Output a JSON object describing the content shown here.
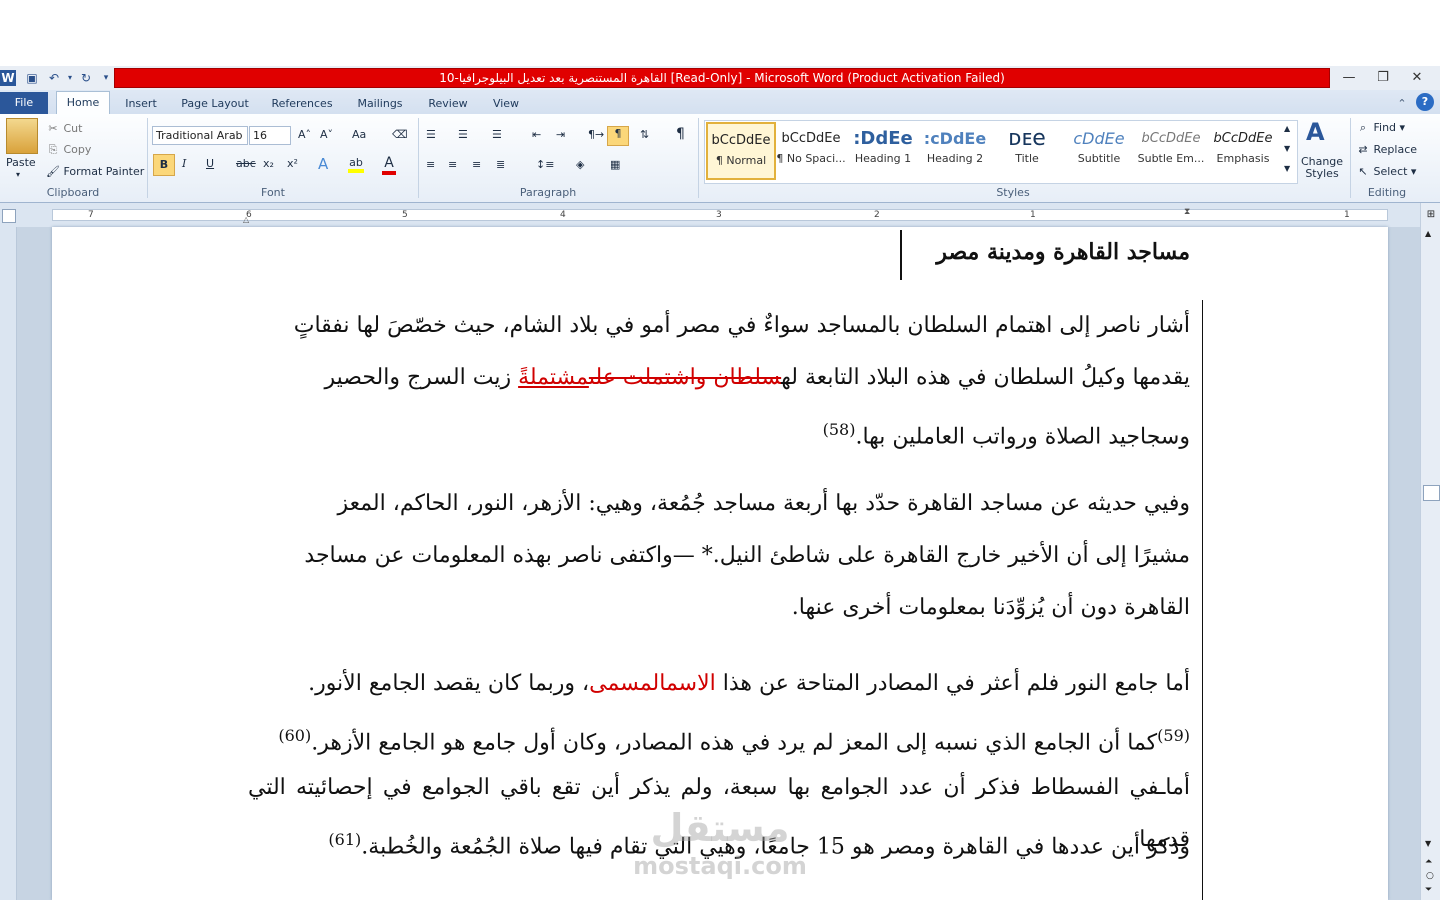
{
  "window": {
    "title": "القاهرة المستنصرية بعد تعديل البيلوجرافيا-10 [Read-Only] - Microsoft Word (Product Activation Failed)",
    "qat": [
      "word-app-icon",
      "save-icon",
      "undo-icon",
      "redo-icon",
      "customize-qat-icon"
    ],
    "controls": [
      "minimize-icon",
      "restore-icon",
      "close-icon"
    ]
  },
  "tabs": [
    "File",
    "Home",
    "Insert",
    "Page Layout",
    "References",
    "Mailings",
    "Review",
    "View"
  ],
  "clipboard": {
    "paste": "Paste",
    "cut": "Cut",
    "copy": "Copy",
    "format_painter": "Format Painter",
    "label": "Clipboard"
  },
  "font": {
    "name": "Traditional Arab",
    "size": "16",
    "label": "Font",
    "bold": "B",
    "italic": "I",
    "underline": "U",
    "strike": "abc",
    "sub": "x₂",
    "sup": "x²",
    "grow": "A˄",
    "shrink": "A˅",
    "case": "Aa",
    "effects": "A",
    "color": "A"
  },
  "paragraph": {
    "label": "Paragraph"
  },
  "styles": {
    "label": "Styles",
    "items": [
      {
        "preview": "bCcDdEe",
        "name": "¶ Normal",
        "color": "#000000"
      },
      {
        "preview": "bCcDdEe",
        "name": "¶ No Spaci...",
        "color": "#000000"
      },
      {
        "preview": ":DdEe",
        "name": "Heading 1",
        "color": "#2e5f9e"
      },
      {
        "preview": ":cDdEe",
        "name": "Heading 2",
        "color": "#4f81bd"
      },
      {
        "preview": "ᴅᴇe",
        "name": "Title",
        "color": "#17365d"
      },
      {
        "preview": "cDdEe",
        "name": "Subtitle",
        "color": "#4f81bd"
      },
      {
        "preview": "bCcDdEe",
        "name": "Subtle Em...",
        "color": "#777777"
      },
      {
        "preview": "bCcDdEe",
        "name": "Emphasis",
        "color": "#000000"
      }
    ],
    "change_styles": "Change Styles"
  },
  "editing": {
    "find": "Find",
    "replace": "Replace",
    "select": "Select",
    "label": "Editing"
  },
  "ruler": {
    "numbers": [
      "7",
      "6",
      "5",
      "4",
      "3",
      "2",
      "1",
      "1"
    ]
  },
  "document": {
    "heading": "مساجد القاهرة ومدينة مصر",
    "p1_l1": "أشار ناصر إلى اهتمام السلطان بالمساجد سواءٌ في مصر أمو في بلاد الشام، حيث خصّصَ لها نفقاتٍ",
    "p1_l2": "يقدمها وكيلُ السلطان في هذه البلاد التابعة له",
    "p1_l2_strike": "سلطان واشتملت على",
    "p1_l2_ins": "مشتملةً",
    "p1_l2_end": "زيت السرج والحصير",
    "p1_l3": "وسجاجيد الصلاة ورواتب العاملين بها.",
    "fn58": "(58)",
    "p2_l1": "وفيي حديثه عن مساجد القاهرة حدّد بها أربعة مساجد جُمُعة، وهيي: الأزهر، النور، الحاكم، المعز",
    "p2_l2": "مشيرًا إلى أن الأخير خارج القاهرة على شاطئ النيل.* —واكتفى ناصر بهذه المعلومات عن مساجد",
    "p2_l3": "القاهرة دون أن يُزوِّدَنا بمعلومات أخرى عنها.",
    "p3_l1": "أما جامع النور فلم أعثر في المصادر المتاحة عن هذا ",
    "p3_l1_red": "الاسمالمسمى",
    "p3_l1_end": "، وربما كان يقصد الجامع الأنور.",
    "p3_l2": "كما أن الجامع الذي نسبه إلى المعز لم يرد في هذه المصادر، وكان أول جامع هو الجامع الأزهر.",
    "fn59": "(59)",
    "fn60": "(60)",
    "p3_l3": "أماـفي الفسطاط فذكر أن عدد الجوامع بها سبعة، ولم يذكر أين تقع باقي الجوامع في إحصائيته التي قدمها",
    "p3_l4": "وذكر أين عددها في القاهرة ومصر هو 15 جامعًا، وهيي التي تقام فيها صلاة الجُمُعة والخُطبة.",
    "fn61": "(61)"
  },
  "watermark": {
    "arabic": "مستقل",
    "latin": "mostaqi.com"
  }
}
